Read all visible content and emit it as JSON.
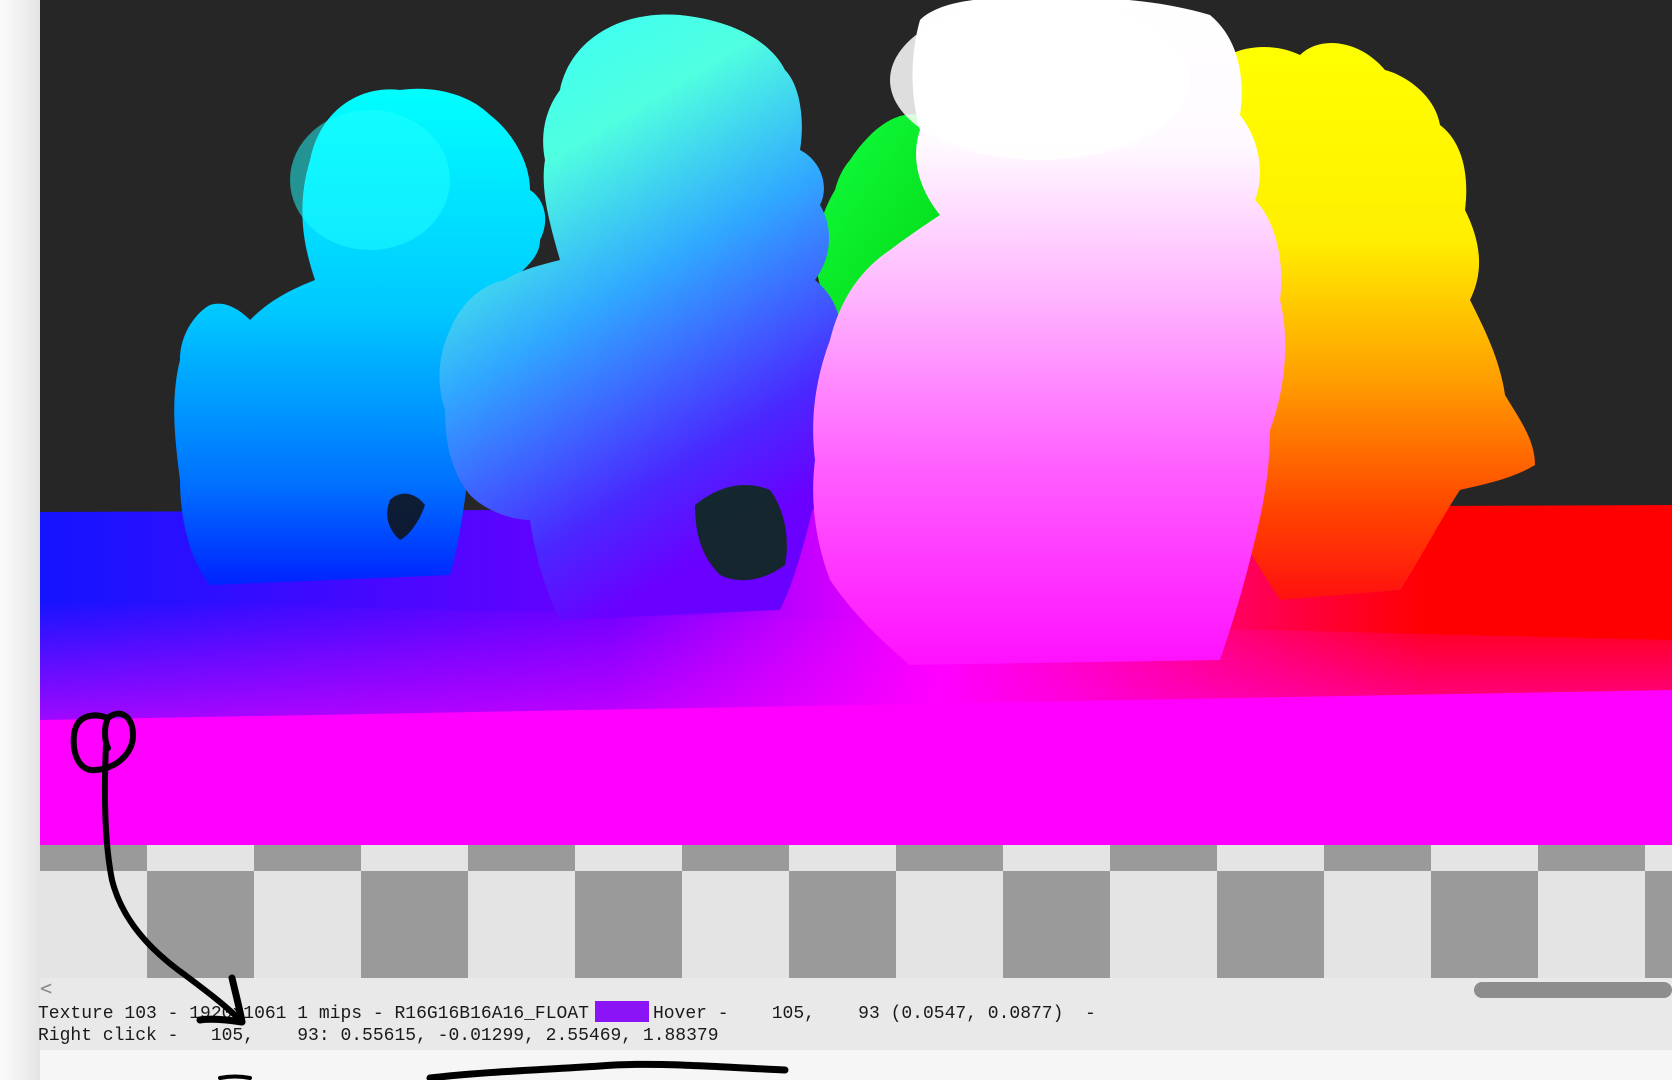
{
  "viewer": {
    "status_line_1": {
      "texture": "Texture 103 -",
      "size_obscured": "1920",
      "size_rest": "x1061 1 mips - R16G16B16A16_FLOAT",
      "hover": "Hover -    105,    93 (0.0547, 0.0877)  -"
    },
    "status_line_2": "Right click -   105,    93: 0.55615, -0.01299, 2.55469, 1.88379",
    "hover_swatch_color": "#8a14f5",
    "scroll_left_glyph": "<"
  },
  "colors": {
    "background_dark": "#262626",
    "floor_blue": "#0000ff",
    "floor_magenta": "#ff00ff",
    "floor_red": "#ff0000",
    "checker_light": "#e4e4e4",
    "checker_dark": "#9a9a9a",
    "annotation_ink": "#000000"
  },
  "icons": [
    "scroll-left-arrow-icon",
    "hand-drawn-arrow-annotation"
  ]
}
